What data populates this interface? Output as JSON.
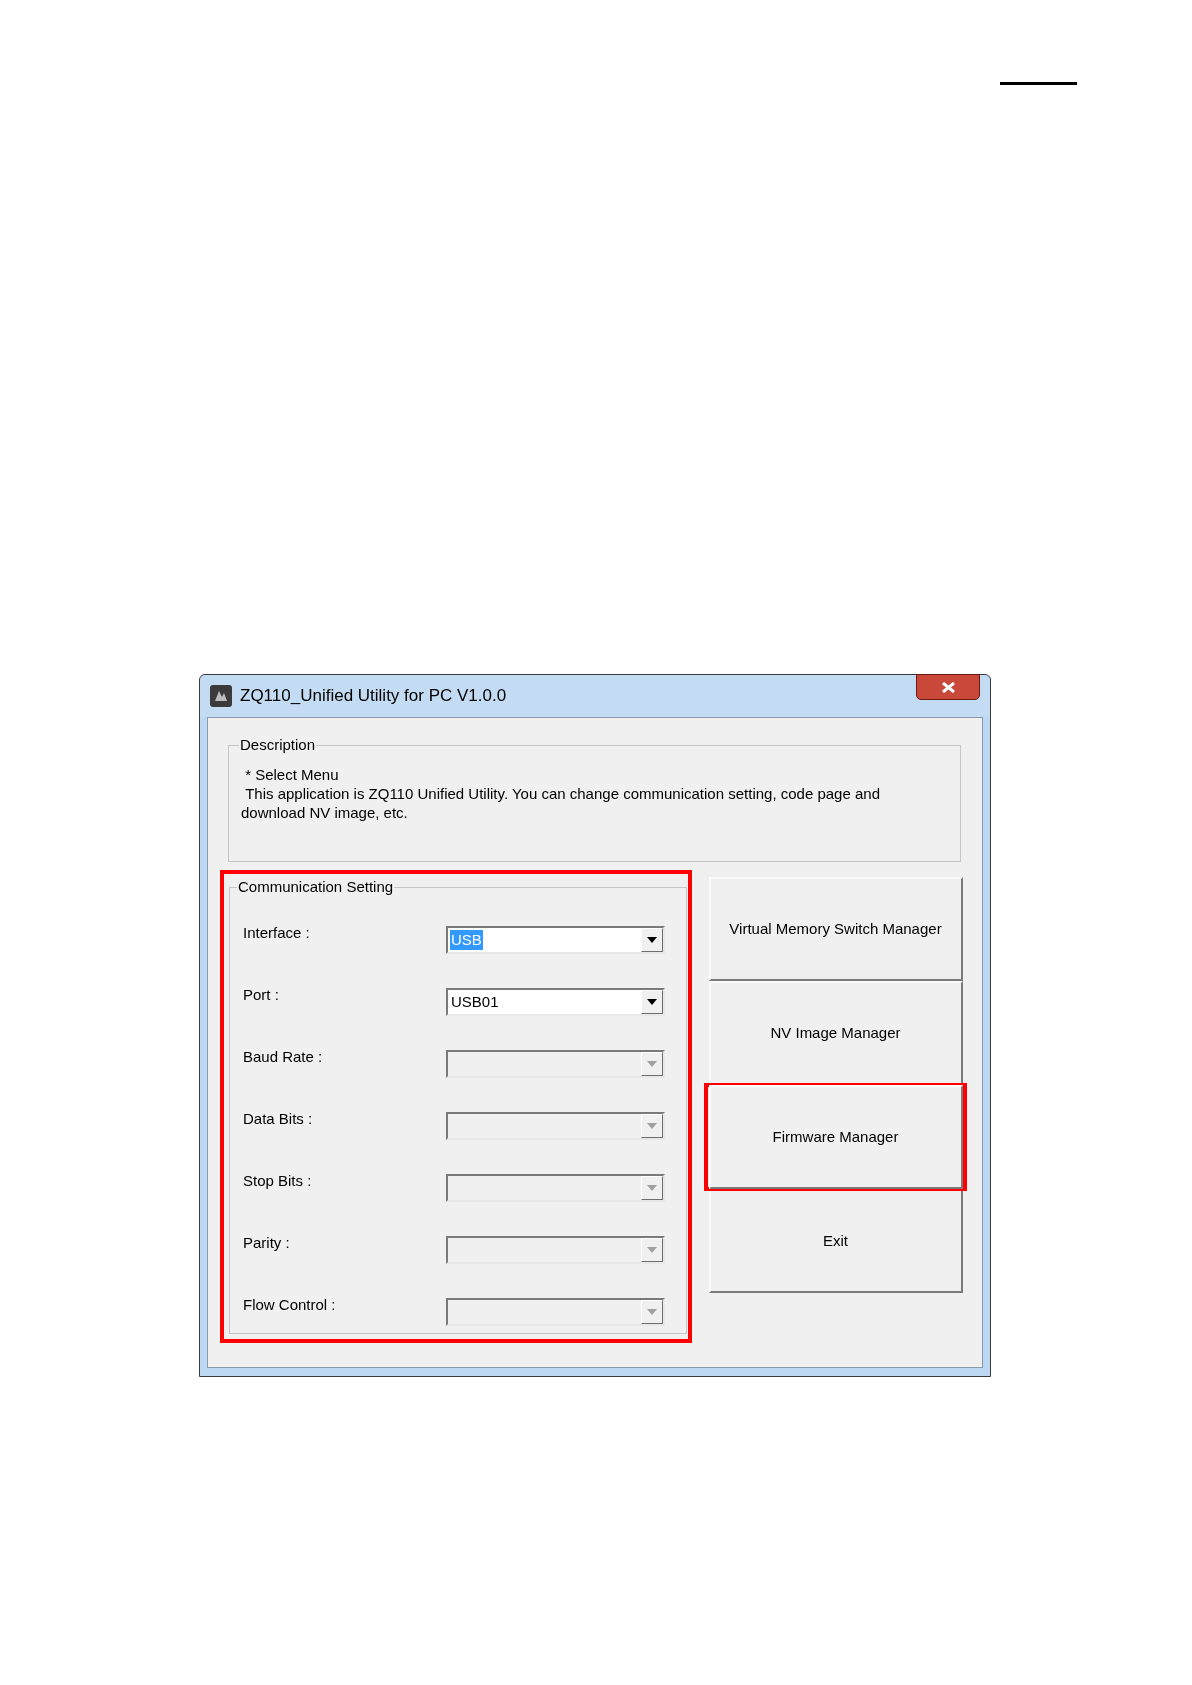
{
  "window": {
    "title": "ZQ110_Unified Utility for PC V1.0.0"
  },
  "description": {
    "legend": "Description",
    "lines": [
      " * Select Menu",
      " This application is ZQ110 Unified Utility. You can change communication setting, code page and download NV image, etc."
    ]
  },
  "communication_setting": {
    "legend": "Communication Setting",
    "highlighted": true,
    "fields": [
      {
        "label": "Interface :",
        "value": "USB",
        "enabled": true,
        "value_selected": true
      },
      {
        "label": "Port :",
        "value": "USB01",
        "enabled": true,
        "value_selected": false
      },
      {
        "label": "Baud Rate :",
        "enabled": false
      },
      {
        "label": "Data Bits :",
        "enabled": false
      },
      {
        "label": "Stop Bits :",
        "enabled": false
      },
      {
        "label": "Parity :",
        "enabled": false
      },
      {
        "label": "Flow Control :",
        "enabled": false
      }
    ]
  },
  "buttons": [
    {
      "label": "Virtual Memory Switch Manager",
      "highlighted": false
    },
    {
      "label": "NV Image Manager",
      "highlighted": false
    },
    {
      "label": "Firmware Manager",
      "highlighted": true
    },
    {
      "label": "Exit",
      "highlighted": false
    }
  ]
}
